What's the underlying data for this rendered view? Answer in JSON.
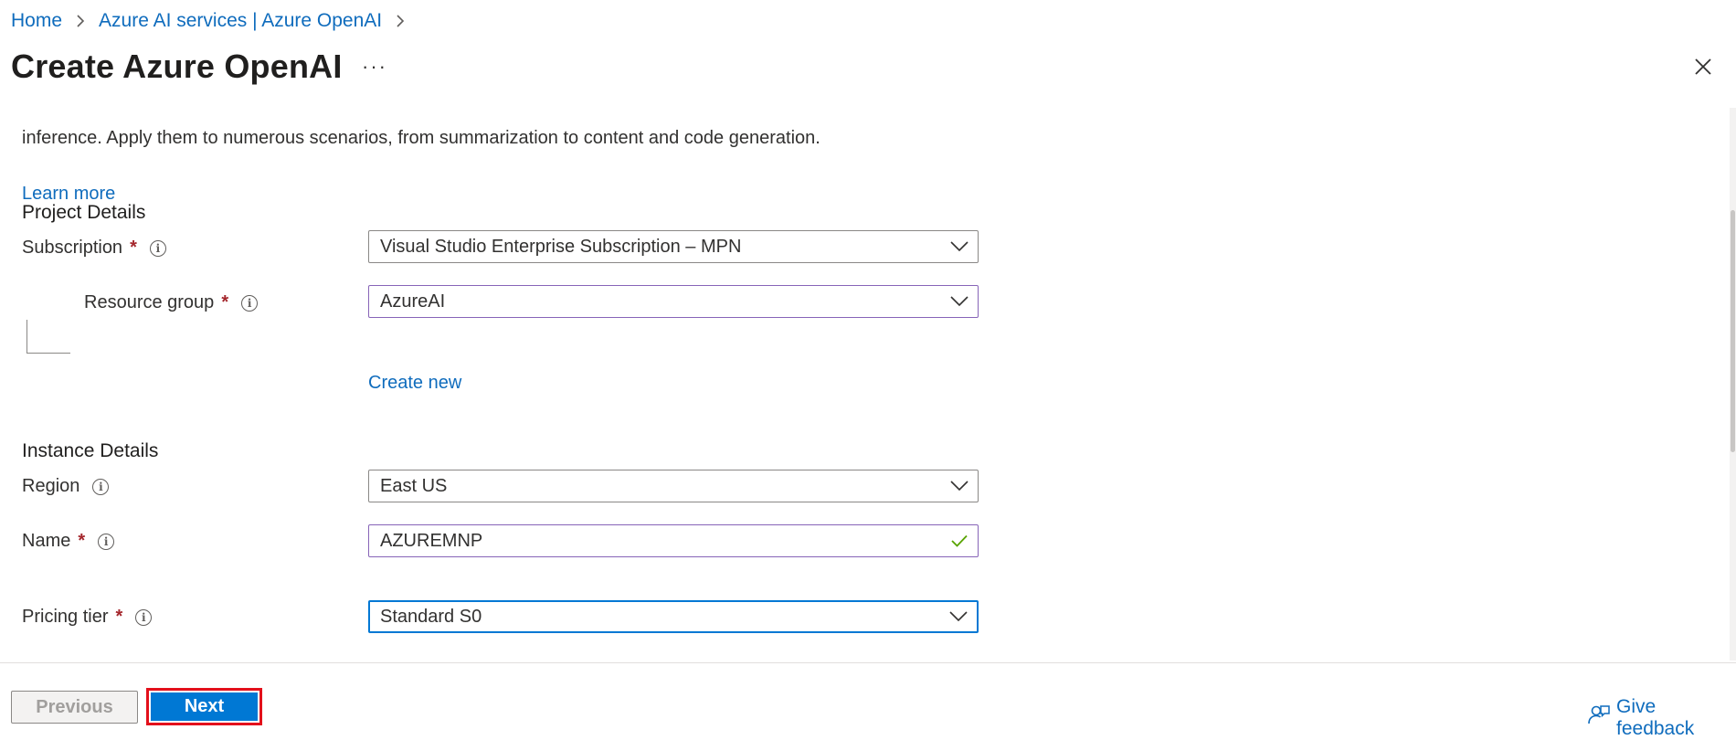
{
  "breadcrumb": {
    "items": [
      "Home",
      "Azure AI services | Azure OpenAI"
    ]
  },
  "page": {
    "title": "Create Azure OpenAI",
    "more_label": "···"
  },
  "intro": {
    "description": "inference. Apply them to numerous scenarios, from summarization to content and code generation.",
    "learn_more": "Learn more"
  },
  "project_details": {
    "heading": "Project Details",
    "subscription": {
      "label": "Subscription",
      "required": "*",
      "value": "Visual Studio Enterprise Subscription – MPN"
    },
    "resource_group": {
      "label": "Resource group",
      "required": "*",
      "value": "AzureAI",
      "create_new": "Create new"
    }
  },
  "instance_details": {
    "heading": "Instance Details",
    "region": {
      "label": "Region",
      "value": "East US"
    },
    "name": {
      "label": "Name",
      "required": "*",
      "value": "AZUREMNP"
    },
    "pricing_tier": {
      "label": "Pricing tier",
      "required": "*",
      "value": "Standard S0"
    }
  },
  "footer": {
    "previous": "Previous",
    "next": "Next",
    "feedback": "Give feedback"
  },
  "colors": {
    "link": "#0f6cbd",
    "primary": "#0078d4",
    "required": "#a4262c",
    "highlight": "#e3101b",
    "valid_check": "#57a300"
  }
}
